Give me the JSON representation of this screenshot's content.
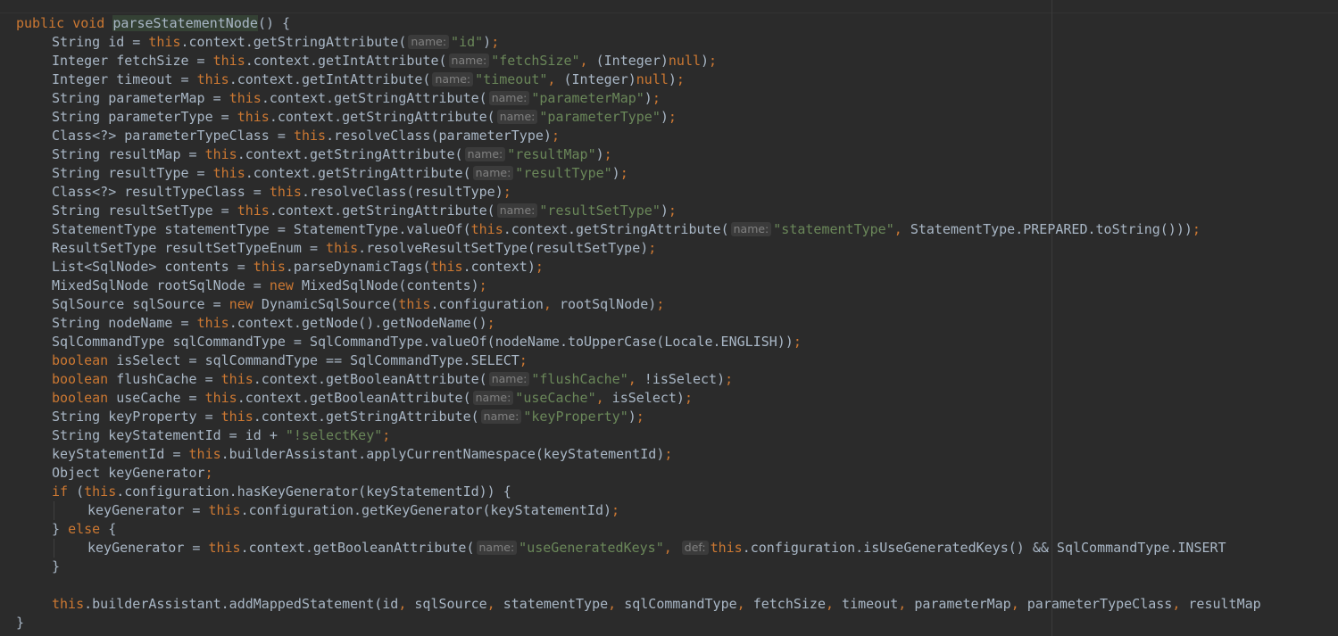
{
  "editor": {
    "lines": [
      {
        "indent": 0,
        "tokens": [
          {
            "t": "kw",
            "v": "public void "
          },
          {
            "t": "hl",
            "v": "parseStatementNode"
          },
          {
            "t": "tx",
            "v": "() {"
          }
        ]
      },
      {
        "indent": 1,
        "tokens": [
          {
            "t": "tx",
            "v": "String id = "
          },
          {
            "t": "kw",
            "v": "this"
          },
          {
            "t": "tx",
            "v": ".context.getStringAttribute("
          },
          {
            "t": "hint",
            "v": "name:"
          },
          {
            "t": "str",
            "v": "\"id\""
          },
          {
            "t": "tx",
            "v": ")"
          },
          {
            "t": "kw",
            "v": ";"
          }
        ]
      },
      {
        "indent": 1,
        "tokens": [
          {
            "t": "tx",
            "v": "Integer fetchSize = "
          },
          {
            "t": "kw",
            "v": "this"
          },
          {
            "t": "tx",
            "v": ".context.getIntAttribute("
          },
          {
            "t": "hint",
            "v": "name:"
          },
          {
            "t": "str",
            "v": "\"fetchSize\""
          },
          {
            "t": "kw",
            "v": ", "
          },
          {
            "t": "tx",
            "v": "(Integer)"
          },
          {
            "t": "kw",
            "v": "null"
          },
          {
            "t": "tx",
            "v": ")"
          },
          {
            "t": "kw",
            "v": ";"
          }
        ]
      },
      {
        "indent": 1,
        "tokens": [
          {
            "t": "tx",
            "v": "Integer timeout = "
          },
          {
            "t": "kw",
            "v": "this"
          },
          {
            "t": "tx",
            "v": ".context.getIntAttribute("
          },
          {
            "t": "hint",
            "v": "name:"
          },
          {
            "t": "str",
            "v": "\"timeout\""
          },
          {
            "t": "kw",
            "v": ", "
          },
          {
            "t": "tx",
            "v": "(Integer)"
          },
          {
            "t": "kw",
            "v": "null"
          },
          {
            "t": "tx",
            "v": ")"
          },
          {
            "t": "kw",
            "v": ";"
          }
        ]
      },
      {
        "indent": 1,
        "tokens": [
          {
            "t": "tx",
            "v": "String parameterMap = "
          },
          {
            "t": "kw",
            "v": "this"
          },
          {
            "t": "tx",
            "v": ".context.getStringAttribute("
          },
          {
            "t": "hint",
            "v": "name:"
          },
          {
            "t": "str",
            "v": "\"parameterMap\""
          },
          {
            "t": "tx",
            "v": ")"
          },
          {
            "t": "kw",
            "v": ";"
          }
        ]
      },
      {
        "indent": 1,
        "tokens": [
          {
            "t": "tx",
            "v": "String parameterType = "
          },
          {
            "t": "kw",
            "v": "this"
          },
          {
            "t": "tx",
            "v": ".context.getStringAttribute("
          },
          {
            "t": "hint",
            "v": "name:"
          },
          {
            "t": "str",
            "v": "\"parameterType\""
          },
          {
            "t": "tx",
            "v": ")"
          },
          {
            "t": "kw",
            "v": ";"
          }
        ]
      },
      {
        "indent": 1,
        "tokens": [
          {
            "t": "tx",
            "v": "Class<?> parameterTypeClass = "
          },
          {
            "t": "kw",
            "v": "this"
          },
          {
            "t": "tx",
            "v": ".resolveClass(parameterType)"
          },
          {
            "t": "kw",
            "v": ";"
          }
        ]
      },
      {
        "indent": 1,
        "tokens": [
          {
            "t": "tx",
            "v": "String resultMap = "
          },
          {
            "t": "kw",
            "v": "this"
          },
          {
            "t": "tx",
            "v": ".context.getStringAttribute("
          },
          {
            "t": "hint",
            "v": "name:"
          },
          {
            "t": "str",
            "v": "\"resultMap\""
          },
          {
            "t": "tx",
            "v": ")"
          },
          {
            "t": "kw",
            "v": ";"
          }
        ]
      },
      {
        "indent": 1,
        "tokens": [
          {
            "t": "tx",
            "v": "String resultType = "
          },
          {
            "t": "kw",
            "v": "this"
          },
          {
            "t": "tx",
            "v": ".context.getStringAttribute("
          },
          {
            "t": "hint",
            "v": "name:"
          },
          {
            "t": "str",
            "v": "\"resultType\""
          },
          {
            "t": "tx",
            "v": ")"
          },
          {
            "t": "kw",
            "v": ";"
          }
        ]
      },
      {
        "indent": 1,
        "tokens": [
          {
            "t": "tx",
            "v": "Class<?> resultTypeClass = "
          },
          {
            "t": "kw",
            "v": "this"
          },
          {
            "t": "tx",
            "v": ".resolveClass(resultType)"
          },
          {
            "t": "kw",
            "v": ";"
          }
        ]
      },
      {
        "indent": 1,
        "tokens": [
          {
            "t": "tx",
            "v": "String resultSetType = "
          },
          {
            "t": "kw",
            "v": "this"
          },
          {
            "t": "tx",
            "v": ".context.getStringAttribute("
          },
          {
            "t": "hint",
            "v": "name:"
          },
          {
            "t": "str",
            "v": "\"resultSetType\""
          },
          {
            "t": "tx",
            "v": ")"
          },
          {
            "t": "kw",
            "v": ";"
          }
        ]
      },
      {
        "indent": 1,
        "tokens": [
          {
            "t": "tx",
            "v": "StatementType statementType = StatementType.valueOf("
          },
          {
            "t": "kw",
            "v": "this"
          },
          {
            "t": "tx",
            "v": ".context.getStringAttribute("
          },
          {
            "t": "hint",
            "v": "name:"
          },
          {
            "t": "str",
            "v": "\"statementType\""
          },
          {
            "t": "kw",
            "v": ", "
          },
          {
            "t": "tx",
            "v": "StatementType.PREPARED.toString()))"
          },
          {
            "t": "kw",
            "v": ";"
          }
        ]
      },
      {
        "indent": 1,
        "tokens": [
          {
            "t": "tx",
            "v": "ResultSetType resultSetTypeEnum = "
          },
          {
            "t": "kw",
            "v": "this"
          },
          {
            "t": "tx",
            "v": ".resolveResultSetType(resultSetType)"
          },
          {
            "t": "kw",
            "v": ";"
          }
        ]
      },
      {
        "indent": 1,
        "tokens": [
          {
            "t": "tx",
            "v": "List<SqlNode> contents = "
          },
          {
            "t": "kw",
            "v": "this"
          },
          {
            "t": "tx",
            "v": ".parseDynamicTags("
          },
          {
            "t": "kw",
            "v": "this"
          },
          {
            "t": "tx",
            "v": ".context)"
          },
          {
            "t": "kw",
            "v": ";"
          }
        ]
      },
      {
        "indent": 1,
        "tokens": [
          {
            "t": "tx",
            "v": "MixedSqlNode rootSqlNode = "
          },
          {
            "t": "kw",
            "v": "new "
          },
          {
            "t": "tx",
            "v": "MixedSqlNode(contents)"
          },
          {
            "t": "kw",
            "v": ";"
          }
        ]
      },
      {
        "indent": 1,
        "tokens": [
          {
            "t": "tx",
            "v": "SqlSource sqlSource = "
          },
          {
            "t": "kw",
            "v": "new "
          },
          {
            "t": "tx",
            "v": "DynamicSqlSource("
          },
          {
            "t": "kw",
            "v": "this"
          },
          {
            "t": "tx",
            "v": ".configuration"
          },
          {
            "t": "kw",
            "v": ", "
          },
          {
            "t": "tx",
            "v": "rootSqlNode)"
          },
          {
            "t": "kw",
            "v": ";"
          }
        ]
      },
      {
        "indent": 1,
        "tokens": [
          {
            "t": "tx",
            "v": "String nodeName = "
          },
          {
            "t": "kw",
            "v": "this"
          },
          {
            "t": "tx",
            "v": ".context.getNode().getNodeName()"
          },
          {
            "t": "kw",
            "v": ";"
          }
        ]
      },
      {
        "indent": 1,
        "tokens": [
          {
            "t": "tx",
            "v": "SqlCommandType sqlCommandType = SqlCommandType.valueOf(nodeName.toUpperCase(Locale.ENGLISH))"
          },
          {
            "t": "kw",
            "v": ";"
          }
        ]
      },
      {
        "indent": 1,
        "tokens": [
          {
            "t": "kw",
            "v": "boolean "
          },
          {
            "t": "tx",
            "v": "isSelect = sqlCommandType == SqlCommandType.SELECT"
          },
          {
            "t": "kw",
            "v": ";"
          }
        ]
      },
      {
        "indent": 1,
        "tokens": [
          {
            "t": "kw",
            "v": "boolean "
          },
          {
            "t": "tx",
            "v": "flushCache = "
          },
          {
            "t": "kw",
            "v": "this"
          },
          {
            "t": "tx",
            "v": ".context.getBooleanAttribute("
          },
          {
            "t": "hint",
            "v": "name:"
          },
          {
            "t": "str",
            "v": "\"flushCache\""
          },
          {
            "t": "kw",
            "v": ", "
          },
          {
            "t": "tx",
            "v": "!isSelect)"
          },
          {
            "t": "kw",
            "v": ";"
          }
        ]
      },
      {
        "indent": 1,
        "tokens": [
          {
            "t": "kw",
            "v": "boolean "
          },
          {
            "t": "tx",
            "v": "useCache = "
          },
          {
            "t": "kw",
            "v": "this"
          },
          {
            "t": "tx",
            "v": ".context.getBooleanAttribute("
          },
          {
            "t": "hint",
            "v": "name:"
          },
          {
            "t": "str",
            "v": "\"useCache\""
          },
          {
            "t": "kw",
            "v": ", "
          },
          {
            "t": "tx",
            "v": "isSelect)"
          },
          {
            "t": "kw",
            "v": ";"
          }
        ]
      },
      {
        "indent": 1,
        "tokens": [
          {
            "t": "tx",
            "v": "String keyProperty = "
          },
          {
            "t": "kw",
            "v": "this"
          },
          {
            "t": "tx",
            "v": ".context.getStringAttribute("
          },
          {
            "t": "hint",
            "v": "name:"
          },
          {
            "t": "str",
            "v": "\"keyProperty\""
          },
          {
            "t": "tx",
            "v": ")"
          },
          {
            "t": "kw",
            "v": ";"
          }
        ]
      },
      {
        "indent": 1,
        "tokens": [
          {
            "t": "tx",
            "v": "String keyStatementId = id + "
          },
          {
            "t": "str",
            "v": "\"!selectKey\""
          },
          {
            "t": "kw",
            "v": ";"
          }
        ]
      },
      {
        "indent": 1,
        "tokens": [
          {
            "t": "tx",
            "v": "keyStatementId = "
          },
          {
            "t": "kw",
            "v": "this"
          },
          {
            "t": "tx",
            "v": ".builderAssistant.applyCurrentNamespace(keyStatementId)"
          },
          {
            "t": "kw",
            "v": ";"
          }
        ]
      },
      {
        "indent": 1,
        "tokens": [
          {
            "t": "tx",
            "v": "Object keyGenerator"
          },
          {
            "t": "kw",
            "v": ";"
          }
        ]
      },
      {
        "indent": 1,
        "tokens": [
          {
            "t": "kw",
            "v": "if "
          },
          {
            "t": "tx",
            "v": "("
          },
          {
            "t": "kw",
            "v": "this"
          },
          {
            "t": "tx",
            "v": ".configuration.hasKeyGenerator(keyStatementId)) {"
          }
        ]
      },
      {
        "indent": 2,
        "guide": true,
        "tokens": [
          {
            "t": "tx",
            "v": "keyGenerator = "
          },
          {
            "t": "kw",
            "v": "this"
          },
          {
            "t": "tx",
            "v": ".configuration.getKeyGenerator(keyStatementId)"
          },
          {
            "t": "kw",
            "v": ";"
          }
        ]
      },
      {
        "indent": 1,
        "tokens": [
          {
            "t": "tx",
            "v": "} "
          },
          {
            "t": "kw",
            "v": "else "
          },
          {
            "t": "tx",
            "v": "{"
          }
        ]
      },
      {
        "indent": 2,
        "guide": true,
        "tokens": [
          {
            "t": "tx",
            "v": "keyGenerator = "
          },
          {
            "t": "kw",
            "v": "this"
          },
          {
            "t": "tx",
            "v": ".context.getBooleanAttribute("
          },
          {
            "t": "hint",
            "v": "name:"
          },
          {
            "t": "str",
            "v": "\"useGeneratedKeys\""
          },
          {
            "t": "kw",
            "v": ", "
          },
          {
            "t": "hint",
            "v": "def:"
          },
          {
            "t": "kw",
            "v": "this"
          },
          {
            "t": "tx",
            "v": ".configuration.isUseGeneratedKeys() && SqlCommandType.INSERT"
          }
        ]
      },
      {
        "indent": 1,
        "tokens": [
          {
            "t": "tx",
            "v": "}"
          }
        ]
      },
      {
        "indent": 0,
        "tokens": []
      },
      {
        "indent": 1,
        "tokens": [
          {
            "t": "kw",
            "v": "this"
          },
          {
            "t": "tx",
            "v": ".builderAssistant.addMappedStatement(id"
          },
          {
            "t": "kw",
            "v": ", "
          },
          {
            "t": "tx",
            "v": "sqlSource"
          },
          {
            "t": "kw",
            "v": ", "
          },
          {
            "t": "tx",
            "v": "statementType"
          },
          {
            "t": "kw",
            "v": ", "
          },
          {
            "t": "tx",
            "v": "sqlCommandType"
          },
          {
            "t": "kw",
            "v": ", "
          },
          {
            "t": "tx",
            "v": "fetchSize"
          },
          {
            "t": "kw",
            "v": ", "
          },
          {
            "t": "tx",
            "v": "timeout"
          },
          {
            "t": "kw",
            "v": ", "
          },
          {
            "t": "tx",
            "v": "parameterMap"
          },
          {
            "t": "kw",
            "v": ", "
          },
          {
            "t": "tx",
            "v": "parameterTypeClass"
          },
          {
            "t": "kw",
            "v": ", "
          },
          {
            "t": "tx",
            "v": "resultMap"
          }
        ]
      },
      {
        "indent": 0,
        "tokens": [
          {
            "t": "tx",
            "v": "}"
          }
        ]
      }
    ]
  },
  "colors": {
    "background": "#2b2b2b",
    "keyword": "#cc7832",
    "string": "#6a8759",
    "text": "#a9b7c6",
    "hint_text": "#808080",
    "hint_bg": "#3b3b3b",
    "method_highlight": "#344134"
  }
}
